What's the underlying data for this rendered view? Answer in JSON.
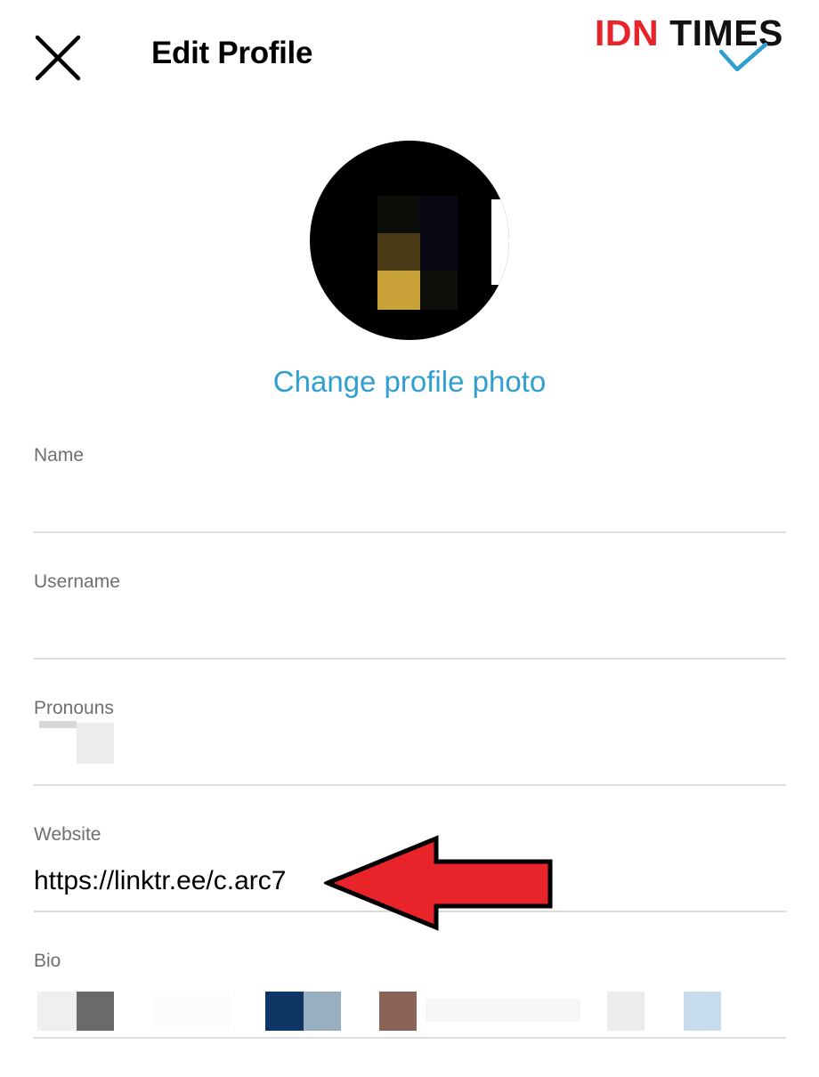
{
  "header": {
    "title": "Edit Profile",
    "close_icon": "close-icon",
    "confirm_icon": "checkmark-icon"
  },
  "watermark": {
    "brand": "IDN",
    "brand2": "TIMES",
    "brand_color": "#e8232a"
  },
  "profile": {
    "change_photo_label": "Change profile photo",
    "link_color": "#2f9fd0"
  },
  "fields": {
    "name": {
      "label": "Name",
      "value": ""
    },
    "username": {
      "label": "Username",
      "value": ""
    },
    "pronouns": {
      "label": "Pronouns",
      "value": ""
    },
    "website": {
      "label": "Website",
      "value": "https://linktr.ee/c.arc7"
    },
    "bio": {
      "label": "Bio",
      "value": ""
    }
  },
  "annotation": {
    "arrow_color": "#e8232a"
  }
}
